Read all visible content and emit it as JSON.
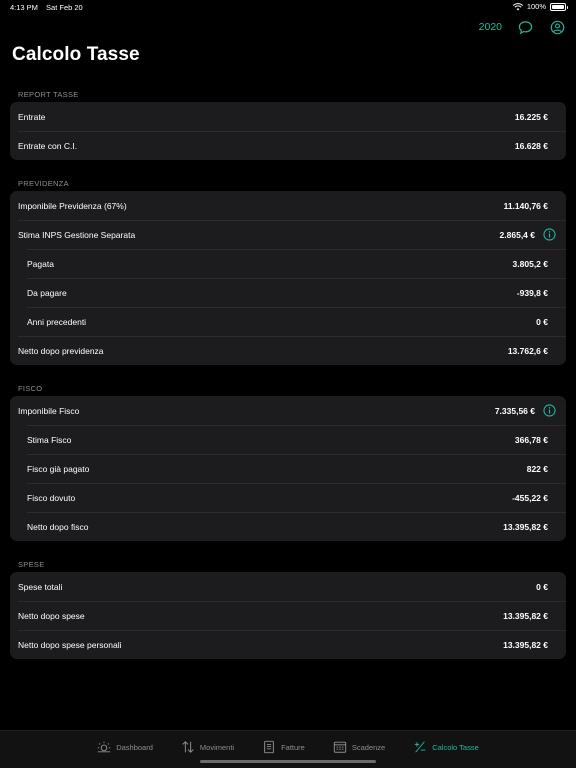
{
  "status_bar": {
    "time": "4:13 PM",
    "date": "Sat Feb 20",
    "battery": "100%"
  },
  "topbar": {
    "year": "2020"
  },
  "title": "Calcolo Tasse",
  "sections": {
    "report": {
      "header": "REPORT TASSE",
      "rows": [
        {
          "label": "Entrate",
          "value": "16.225 €"
        },
        {
          "label": "Entrate con C.I.",
          "value": "16.628 €"
        }
      ]
    },
    "previdenza": {
      "header": "PREVIDENZA",
      "rows": [
        {
          "label": "Imponibile Previdenza (67%)",
          "value": "11.140,76 €"
        },
        {
          "label": "Stima INPS Gestione Separata",
          "value": "2.865,4 €"
        },
        {
          "label": "Pagata",
          "value": "3.805,2 €"
        },
        {
          "label": "Da pagare",
          "value": "-939,8 €"
        },
        {
          "label": "Anni precedenti",
          "value": "0 €"
        },
        {
          "label": "Netto dopo previdenza",
          "value": "13.762,6 €"
        }
      ]
    },
    "fisco": {
      "header": "FISCO",
      "rows": [
        {
          "label": "Imponibile Fisco",
          "value": "7.335,56 €"
        },
        {
          "label": "Stima Fisco",
          "value": "366,78 €"
        },
        {
          "label": "Fisco già pagato",
          "value": "822 €"
        },
        {
          "label": "Fisco dovuto",
          "value": "-455,22 €"
        },
        {
          "label": "Netto dopo fisco",
          "value": "13.395,82 €"
        }
      ]
    },
    "spese": {
      "header": "SPESE",
      "rows": [
        {
          "label": "Spese totali",
          "value": "0 €"
        },
        {
          "label": "Netto dopo spese",
          "value": "13.395,82 €"
        },
        {
          "label": "Netto dopo spese personali",
          "value": "13.395,82 €"
        }
      ]
    }
  },
  "tabs": [
    {
      "label": "Dashboard",
      "icon": "sun-icon"
    },
    {
      "label": "Movimenti",
      "icon": "arrows-updown-icon"
    },
    {
      "label": "Fatture",
      "icon": "document-icon"
    },
    {
      "label": "Scadenze",
      "icon": "calendar-icon"
    },
    {
      "label": "Calcolo Tasse",
      "icon": "plus-minus-icon",
      "active": true
    }
  ],
  "colors": {
    "accent": "#1fb9a0",
    "card": "#1c1c1e",
    "background": "#000000"
  }
}
